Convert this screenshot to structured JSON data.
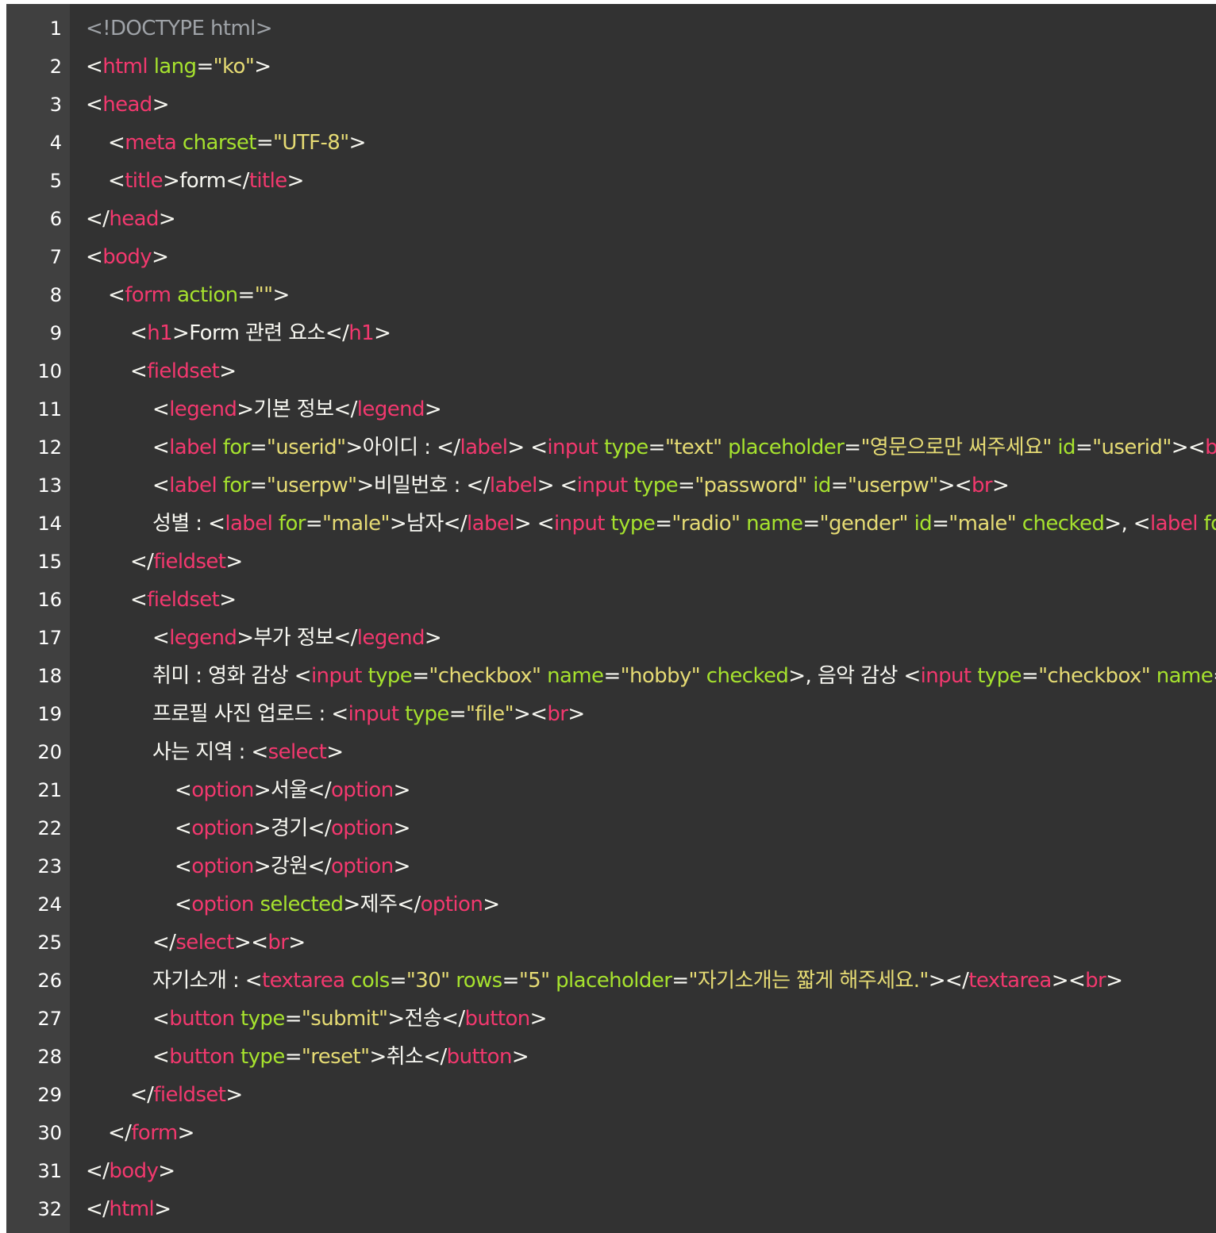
{
  "theme": {
    "background": "#323232",
    "gutter": "#404040",
    "colors": {
      "comment": "#9fa3a8",
      "tag": "#f2386e",
      "attr": "#a6e22e",
      "str": "#e6db74",
      "punct": "#f8f8f2",
      "text": "#f8f8f2"
    }
  },
  "lines": [
    {
      "n": "1",
      "indent": 0,
      "tokens": [
        [
          "comment",
          "<!DOCTYPE html>"
        ]
      ]
    },
    {
      "n": "2",
      "indent": 0,
      "tokens": [
        [
          "punct",
          "<"
        ],
        [
          "tag",
          "html"
        ],
        [
          "punct",
          " "
        ],
        [
          "attr",
          "lang"
        ],
        [
          "punct",
          "="
        ],
        [
          "str",
          "\"ko\""
        ],
        [
          "punct",
          ">"
        ]
      ]
    },
    {
      "n": "3",
      "indent": 0,
      "tokens": [
        [
          "punct",
          "<"
        ],
        [
          "tag",
          "head"
        ],
        [
          "punct",
          ">"
        ]
      ]
    },
    {
      "n": "4",
      "indent": 1,
      "tokens": [
        [
          "punct",
          "<"
        ],
        [
          "tag",
          "meta"
        ],
        [
          "punct",
          " "
        ],
        [
          "attr",
          "charset"
        ],
        [
          "punct",
          "="
        ],
        [
          "str",
          "\"UTF-8\""
        ],
        [
          "punct",
          ">"
        ]
      ]
    },
    {
      "n": "5",
      "indent": 1,
      "tokens": [
        [
          "punct",
          "<"
        ],
        [
          "tag",
          "title"
        ],
        [
          "punct",
          ">"
        ],
        [
          "text",
          "form"
        ],
        [
          "punct",
          "</"
        ],
        [
          "tag",
          "title"
        ],
        [
          "punct",
          ">"
        ]
      ]
    },
    {
      "n": "6",
      "indent": 0,
      "tokens": [
        [
          "punct",
          "</"
        ],
        [
          "tag",
          "head"
        ],
        [
          "punct",
          ">"
        ]
      ]
    },
    {
      "n": "7",
      "indent": 0,
      "tokens": [
        [
          "punct",
          "<"
        ],
        [
          "tag",
          "body"
        ],
        [
          "punct",
          ">"
        ]
      ]
    },
    {
      "n": "8",
      "indent": 1,
      "tokens": [
        [
          "punct",
          "<"
        ],
        [
          "tag",
          "form"
        ],
        [
          "punct",
          " "
        ],
        [
          "attr",
          "action"
        ],
        [
          "punct",
          "="
        ],
        [
          "str",
          "\"\""
        ],
        [
          "punct",
          ">"
        ]
      ]
    },
    {
      "n": "9",
      "indent": 2,
      "tokens": [
        [
          "punct",
          "<"
        ],
        [
          "tag",
          "h1"
        ],
        [
          "punct",
          ">"
        ],
        [
          "text",
          "Form 관련 요소"
        ],
        [
          "punct",
          "</"
        ],
        [
          "tag",
          "h1"
        ],
        [
          "punct",
          ">"
        ]
      ]
    },
    {
      "n": "10",
      "indent": 2,
      "tokens": [
        [
          "punct",
          "<"
        ],
        [
          "tag",
          "fieldset"
        ],
        [
          "punct",
          ">"
        ]
      ]
    },
    {
      "n": "11",
      "indent": 3,
      "tokens": [
        [
          "punct",
          "<"
        ],
        [
          "tag",
          "legend"
        ],
        [
          "punct",
          ">"
        ],
        [
          "text",
          "기본 정보"
        ],
        [
          "punct",
          "</"
        ],
        [
          "tag",
          "legend"
        ],
        [
          "punct",
          ">"
        ]
      ]
    },
    {
      "n": "12",
      "indent": 3,
      "tokens": [
        [
          "punct",
          "<"
        ],
        [
          "tag",
          "label"
        ],
        [
          "punct",
          " "
        ],
        [
          "attr",
          "for"
        ],
        [
          "punct",
          "="
        ],
        [
          "str",
          "\"userid\""
        ],
        [
          "punct",
          ">"
        ],
        [
          "text",
          "아이디 : "
        ],
        [
          "punct",
          "</"
        ],
        [
          "tag",
          "label"
        ],
        [
          "punct",
          "> <"
        ],
        [
          "tag",
          "input"
        ],
        [
          "punct",
          " "
        ],
        [
          "attr",
          "type"
        ],
        [
          "punct",
          "="
        ],
        [
          "str",
          "\"text\""
        ],
        [
          "punct",
          " "
        ],
        [
          "attr",
          "placeholder"
        ],
        [
          "punct",
          "="
        ],
        [
          "str",
          "\"영문으로만 써주세요\""
        ],
        [
          "punct",
          " "
        ],
        [
          "attr",
          "id"
        ],
        [
          "punct",
          "="
        ],
        [
          "str",
          "\"userid\""
        ],
        [
          "punct",
          "><"
        ],
        [
          "tag",
          "br"
        ],
        [
          "punct",
          ">"
        ]
      ]
    },
    {
      "n": "13",
      "indent": 3,
      "tokens": [
        [
          "punct",
          "<"
        ],
        [
          "tag",
          "label"
        ],
        [
          "punct",
          " "
        ],
        [
          "attr",
          "for"
        ],
        [
          "punct",
          "="
        ],
        [
          "str",
          "\"userpw\""
        ],
        [
          "punct",
          ">"
        ],
        [
          "text",
          "비밀번호 : "
        ],
        [
          "punct",
          "</"
        ],
        [
          "tag",
          "label"
        ],
        [
          "punct",
          "> <"
        ],
        [
          "tag",
          "input"
        ],
        [
          "punct",
          " "
        ],
        [
          "attr",
          "type"
        ],
        [
          "punct",
          "="
        ],
        [
          "str",
          "\"password\""
        ],
        [
          "punct",
          " "
        ],
        [
          "attr",
          "id"
        ],
        [
          "punct",
          "="
        ],
        [
          "str",
          "\"userpw\""
        ],
        [
          "punct",
          "><"
        ],
        [
          "tag",
          "br"
        ],
        [
          "punct",
          ">"
        ]
      ]
    },
    {
      "n": "14",
      "indent": 3,
      "tokens": [
        [
          "text",
          "성별 : "
        ],
        [
          "punct",
          "<"
        ],
        [
          "tag",
          "label"
        ],
        [
          "punct",
          " "
        ],
        [
          "attr",
          "for"
        ],
        [
          "punct",
          "="
        ],
        [
          "str",
          "\"male\""
        ],
        [
          "punct",
          ">"
        ],
        [
          "text",
          "남자"
        ],
        [
          "punct",
          "</"
        ],
        [
          "tag",
          "label"
        ],
        [
          "punct",
          "> <"
        ],
        [
          "tag",
          "input"
        ],
        [
          "punct",
          " "
        ],
        [
          "attr",
          "type"
        ],
        [
          "punct",
          "="
        ],
        [
          "str",
          "\"radio\""
        ],
        [
          "punct",
          " "
        ],
        [
          "attr",
          "name"
        ],
        [
          "punct",
          "="
        ],
        [
          "str",
          "\"gender\""
        ],
        [
          "punct",
          " "
        ],
        [
          "attr",
          "id"
        ],
        [
          "punct",
          "="
        ],
        [
          "str",
          "\"male\""
        ],
        [
          "punct",
          " "
        ],
        [
          "attr",
          "checked"
        ],
        [
          "punct",
          ">, <"
        ],
        [
          "tag",
          "label"
        ],
        [
          "punct",
          " "
        ],
        [
          "attr",
          "for"
        ],
        [
          "punct",
          "="
        ],
        [
          "str",
          "\""
        ]
      ]
    },
    {
      "n": "15",
      "indent": 2,
      "tokens": [
        [
          "punct",
          "</"
        ],
        [
          "tag",
          "fieldset"
        ],
        [
          "punct",
          ">"
        ]
      ]
    },
    {
      "n": "16",
      "indent": 2,
      "tokens": [
        [
          "punct",
          "<"
        ],
        [
          "tag",
          "fieldset"
        ],
        [
          "punct",
          ">"
        ]
      ]
    },
    {
      "n": "17",
      "indent": 3,
      "tokens": [
        [
          "punct",
          "<"
        ],
        [
          "tag",
          "legend"
        ],
        [
          "punct",
          ">"
        ],
        [
          "text",
          "부가 정보"
        ],
        [
          "punct",
          "</"
        ],
        [
          "tag",
          "legend"
        ],
        [
          "punct",
          ">"
        ]
      ]
    },
    {
      "n": "18",
      "indent": 3,
      "tokens": [
        [
          "text",
          "취미 : 영화 감상 "
        ],
        [
          "punct",
          "<"
        ],
        [
          "tag",
          "input"
        ],
        [
          "punct",
          " "
        ],
        [
          "attr",
          "type"
        ],
        [
          "punct",
          "="
        ],
        [
          "str",
          "\"checkbox\""
        ],
        [
          "punct",
          " "
        ],
        [
          "attr",
          "name"
        ],
        [
          "punct",
          "="
        ],
        [
          "str",
          "\"hobby\""
        ],
        [
          "punct",
          " "
        ],
        [
          "attr",
          "checked"
        ],
        [
          "punct",
          ">"
        ],
        [
          "text",
          ", 음악 감상 "
        ],
        [
          "punct",
          "<"
        ],
        [
          "tag",
          "input"
        ],
        [
          "punct",
          " "
        ],
        [
          "attr",
          "type"
        ],
        [
          "punct",
          "="
        ],
        [
          "str",
          "\"checkbox\""
        ],
        [
          "punct",
          " "
        ],
        [
          "attr",
          "name"
        ],
        [
          "punct",
          "="
        ]
      ]
    },
    {
      "n": "19",
      "indent": 3,
      "tokens": [
        [
          "text",
          "프로필 사진 업로드 : "
        ],
        [
          "punct",
          "<"
        ],
        [
          "tag",
          "input"
        ],
        [
          "punct",
          " "
        ],
        [
          "attr",
          "type"
        ],
        [
          "punct",
          "="
        ],
        [
          "str",
          "\"file\""
        ],
        [
          "punct",
          "><"
        ],
        [
          "tag",
          "br"
        ],
        [
          "punct",
          ">"
        ]
      ]
    },
    {
      "n": "20",
      "indent": 3,
      "tokens": [
        [
          "text",
          "사는 지역 : "
        ],
        [
          "punct",
          "<"
        ],
        [
          "tag",
          "select"
        ],
        [
          "punct",
          ">"
        ]
      ]
    },
    {
      "n": "21",
      "indent": 4,
      "tokens": [
        [
          "punct",
          "<"
        ],
        [
          "tag",
          "option"
        ],
        [
          "punct",
          ">"
        ],
        [
          "text",
          "서울"
        ],
        [
          "punct",
          "</"
        ],
        [
          "tag",
          "option"
        ],
        [
          "punct",
          ">"
        ]
      ]
    },
    {
      "n": "22",
      "indent": 4,
      "tokens": [
        [
          "punct",
          "<"
        ],
        [
          "tag",
          "option"
        ],
        [
          "punct",
          ">"
        ],
        [
          "text",
          "경기"
        ],
        [
          "punct",
          "</"
        ],
        [
          "tag",
          "option"
        ],
        [
          "punct",
          ">"
        ]
      ]
    },
    {
      "n": "23",
      "indent": 4,
      "tokens": [
        [
          "punct",
          "<"
        ],
        [
          "tag",
          "option"
        ],
        [
          "punct",
          ">"
        ],
        [
          "text",
          "강원"
        ],
        [
          "punct",
          "</"
        ],
        [
          "tag",
          "option"
        ],
        [
          "punct",
          ">"
        ]
      ]
    },
    {
      "n": "24",
      "indent": 4,
      "tokens": [
        [
          "punct",
          "<"
        ],
        [
          "tag",
          "option"
        ],
        [
          "punct",
          " "
        ],
        [
          "attr",
          "selected"
        ],
        [
          "punct",
          ">"
        ],
        [
          "text",
          "제주"
        ],
        [
          "punct",
          "</"
        ],
        [
          "tag",
          "option"
        ],
        [
          "punct",
          ">"
        ]
      ]
    },
    {
      "n": "25",
      "indent": 3,
      "tokens": [
        [
          "punct",
          "</"
        ],
        [
          "tag",
          "select"
        ],
        [
          "punct",
          "><"
        ],
        [
          "tag",
          "br"
        ],
        [
          "punct",
          ">"
        ]
      ]
    },
    {
      "n": "26",
      "indent": 3,
      "tokens": [
        [
          "text",
          "자기소개 : "
        ],
        [
          "punct",
          "<"
        ],
        [
          "tag",
          "textarea"
        ],
        [
          "punct",
          " "
        ],
        [
          "attr",
          "cols"
        ],
        [
          "punct",
          "="
        ],
        [
          "str",
          "\"30\""
        ],
        [
          "punct",
          " "
        ],
        [
          "attr",
          "rows"
        ],
        [
          "punct",
          "="
        ],
        [
          "str",
          "\"5\""
        ],
        [
          "punct",
          " "
        ],
        [
          "attr",
          "placeholder"
        ],
        [
          "punct",
          "="
        ],
        [
          "str",
          "\"자기소개는 짧게 해주세요.\""
        ],
        [
          "punct",
          "></"
        ],
        [
          "tag",
          "textarea"
        ],
        [
          "punct",
          "><"
        ],
        [
          "tag",
          "br"
        ],
        [
          "punct",
          ">"
        ]
      ]
    },
    {
      "n": "27",
      "indent": 3,
      "tokens": [
        [
          "punct",
          "<"
        ],
        [
          "tag",
          "button"
        ],
        [
          "punct",
          " "
        ],
        [
          "attr",
          "type"
        ],
        [
          "punct",
          "="
        ],
        [
          "str",
          "\"submit\""
        ],
        [
          "punct",
          ">"
        ],
        [
          "text",
          "전송"
        ],
        [
          "punct",
          "</"
        ],
        [
          "tag",
          "button"
        ],
        [
          "punct",
          ">"
        ]
      ]
    },
    {
      "n": "28",
      "indent": 3,
      "tokens": [
        [
          "punct",
          "<"
        ],
        [
          "tag",
          "button"
        ],
        [
          "punct",
          " "
        ],
        [
          "attr",
          "type"
        ],
        [
          "punct",
          "="
        ],
        [
          "str",
          "\"reset\""
        ],
        [
          "punct",
          ">"
        ],
        [
          "text",
          "취소"
        ],
        [
          "punct",
          "</"
        ],
        [
          "tag",
          "button"
        ],
        [
          "punct",
          ">"
        ]
      ]
    },
    {
      "n": "29",
      "indent": 2,
      "tokens": [
        [
          "punct",
          "</"
        ],
        [
          "tag",
          "fieldset"
        ],
        [
          "punct",
          ">"
        ]
      ]
    },
    {
      "n": "30",
      "indent": 1,
      "tokens": [
        [
          "punct",
          "</"
        ],
        [
          "tag",
          "form"
        ],
        [
          "punct",
          ">"
        ]
      ]
    },
    {
      "n": "31",
      "indent": 0,
      "tokens": [
        [
          "punct",
          "</"
        ],
        [
          "tag",
          "body"
        ],
        [
          "punct",
          ">"
        ]
      ]
    },
    {
      "n": "32",
      "indent": 0,
      "tokens": [
        [
          "punct",
          "</"
        ],
        [
          "tag",
          "html"
        ],
        [
          "punct",
          ">"
        ]
      ]
    }
  ]
}
